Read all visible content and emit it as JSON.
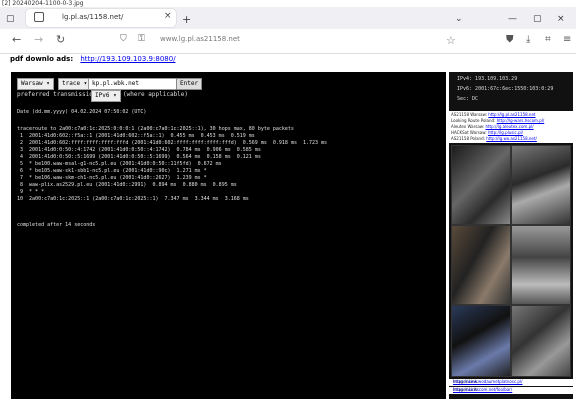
{
  "file_label": "[2] 20240204-1100-0-3.jpg",
  "browser": {
    "tab_title": "lg.pl.as/1158.net/",
    "url": "www.lg.pl.as21158.net"
  },
  "page": {
    "heading_label": "pdf downlo ads:",
    "heading_link": "http://193.109.103.9:8080/"
  },
  "form": {
    "provider": "Warsaw",
    "command": "trace",
    "target": "kp.pl.wbk.net",
    "enter_label": "Enter",
    "protocol_label": "preferred transmission",
    "protocol_value": "IPv6",
    "protocol_note": "(where applicable)"
  },
  "output": {
    "date_line": "Date (dd.mm.yyyy) 04.02.2024 07:50:02 (UTC)",
    "lines": [
      "traceroute to 2a00:c7a0:1c:2025:0:0:0:1 (2a00:c7a0:1c:2025::1), 30 hops max, 80 byte packets",
      " 1  2001:41d0:602::f5a::1 (2001:41d0:602::f5a::1)  0.455 ms  0.453 ms  0.519 ms",
      " 2  2001:41d0:602:ffff:ffff:ffff:fffd (2001:41d0:602:ffff:ffff:ffff:fffd)  0.569 ms  0.918 ms  1.723 ms",
      " 3  2001:41d0:0:50::4:1742 (2001:41d0:0:50::4:1742)  0.784 ms  0.906 ms  0.585 ms",
      " 4  2001:41d0:0:50::5:1699 (2001:41d0:0:50::5:1699)  0.564 ms  0.158 ms  0.121 ms",
      " 5  * be100.waw-msal-g1-nc5.pl.eu (2001:41d0:0:50::11f5fd)  0.672 ms",
      " 6  * be105.waw-sk1-sbb1-nc5.pl.eu (2001:41d0::90c)  1.271 ms *",
      " 7  * be106.waw-skm-ch1-nc5.pl.eu (2001:41d0::2627)  1.239 ms *",
      " 8  waw-plix.as2529.pl.eu (2001:41d0::2991)  0.894 ms  0.880 ms  0.895 ms",
      " 9  * * *",
      "10  2a00:c7a0:1c:2025::1 (2a00:c7a0:1c:2025::1)  7.347 ms  3.344 ms  3.168 ms"
    ],
    "footer": "completed after 14 seconds"
  },
  "sidebar": {
    "info": [
      "IPv4: 193.109.103.29",
      "IPv6: 2001:67c:6ec:1550:103:0:29",
      "Sec: DC"
    ],
    "links": [
      {
        "text": "AS21158 Warsaw:",
        "url": "http://lg.pl.as21158.net"
      },
      {
        "text": "Looking Route Poland:",
        "url": "http://lg-wars.hscom.pl/"
      },
      {
        "text": "Aleutex Warsaw:",
        "url": "http://lg.aleutex.com.pl/"
      },
      {
        "text": "HACKSat Warsaw:",
        "url": "http://lg.plusic.pl/"
      },
      {
        "text": "AS21158 Poland:",
        "url": "http://lg.wo.as21158.net/"
      }
    ],
    "footer": [
      {
        "text": "Images Link:",
        "url": "https://www.wodaumetplatnosc.pl/"
      },
      {
        "text": "Images Link:",
        "url": "https://wo.hscom.net/foo/bar/"
      }
    ]
  }
}
